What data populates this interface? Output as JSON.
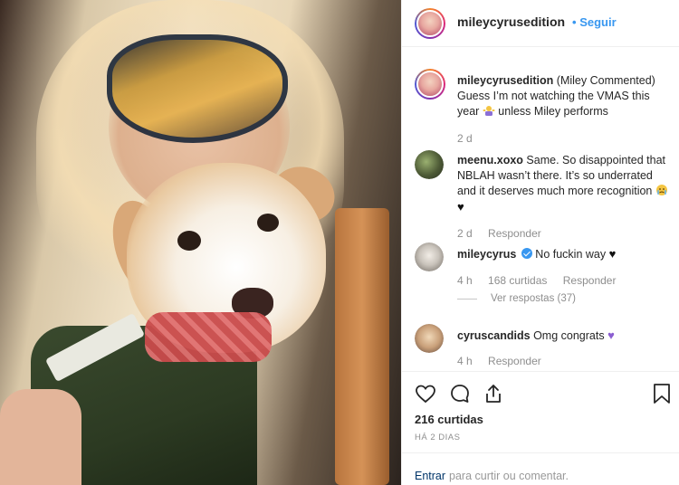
{
  "post": {
    "account": "mileycyrusedition",
    "follow_label": "Seguir",
    "caption_user": "mileycyrusedition",
    "caption_text": "(Miley Commented) Guess I’m not watching the VMAS this year",
    "caption_text_end": "unless Miley performs",
    "caption_time": "2 d"
  },
  "comments": [
    {
      "user": "meenu.xoxo",
      "text": "Same. So disappointed that NBLAH wasn’t there. It’s so underrated and it deserves much more recognition",
      "time": "2 d",
      "reply_label": "Responder"
    },
    {
      "user": "mileycyrus",
      "verified": true,
      "text": "No fuckin way",
      "time": "4 h",
      "likes_label": "168 curtidas",
      "reply_label": "Responder",
      "view_replies": "Ver respostas (37)"
    },
    {
      "user": "cyruscandids",
      "text": "Omg congrats",
      "time": "4 h",
      "reply_label": "Responder"
    }
  ],
  "stats": {
    "likes": "216 curtidas",
    "posted_ago": "HÁ 2 DIAS"
  },
  "footer": {
    "login_link": "Entrar",
    "login_rest": "para curtir ou comentar."
  },
  "icons": {
    "like": "heart-outline-icon",
    "comment": "comment-bubble-icon",
    "share": "share-icon",
    "save": "bookmark-icon",
    "verified": "verified-badge-icon"
  },
  "colors": {
    "link_blue": "#3897f0",
    "text": "#262626",
    "muted": "#8e8e8e"
  }
}
